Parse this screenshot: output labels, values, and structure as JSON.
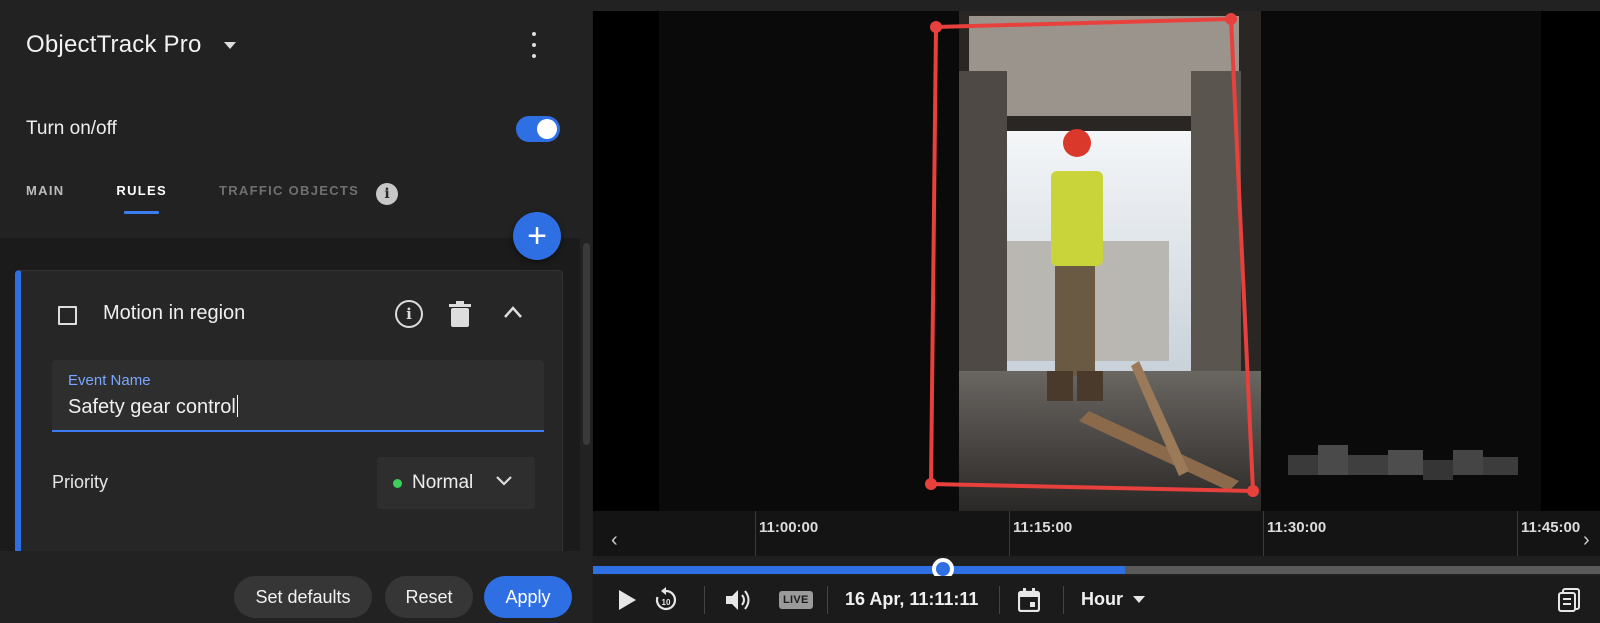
{
  "app": {
    "title": "ObjectTrack Pro"
  },
  "toggle": {
    "label": "Turn on/off",
    "on": true
  },
  "tabs": [
    {
      "label": "MAIN",
      "active": false
    },
    {
      "label": "RULES",
      "active": true
    },
    {
      "label": "TRAFFIC OBJECTS",
      "active": false
    }
  ],
  "rule": {
    "title": "Motion in region",
    "event_name_label": "Event Name",
    "event_name_value": "Safety gear control",
    "priority_label": "Priority",
    "priority_value": "Normal"
  },
  "footer": {
    "set_defaults": "Set defaults",
    "reset": "Reset",
    "apply": "Apply"
  },
  "timeline": {
    "labels": [
      "11:00:00",
      "11:15:00",
      "11:30:00",
      "11:45:00"
    ]
  },
  "controls": {
    "live": "LIVE",
    "datetime": "16 Apr, 11:11:11",
    "range": "Hour"
  },
  "colors": {
    "accent": "#2f6fe4",
    "bbox": "#e8403c",
    "priority_dot": "#3ecf5a"
  }
}
